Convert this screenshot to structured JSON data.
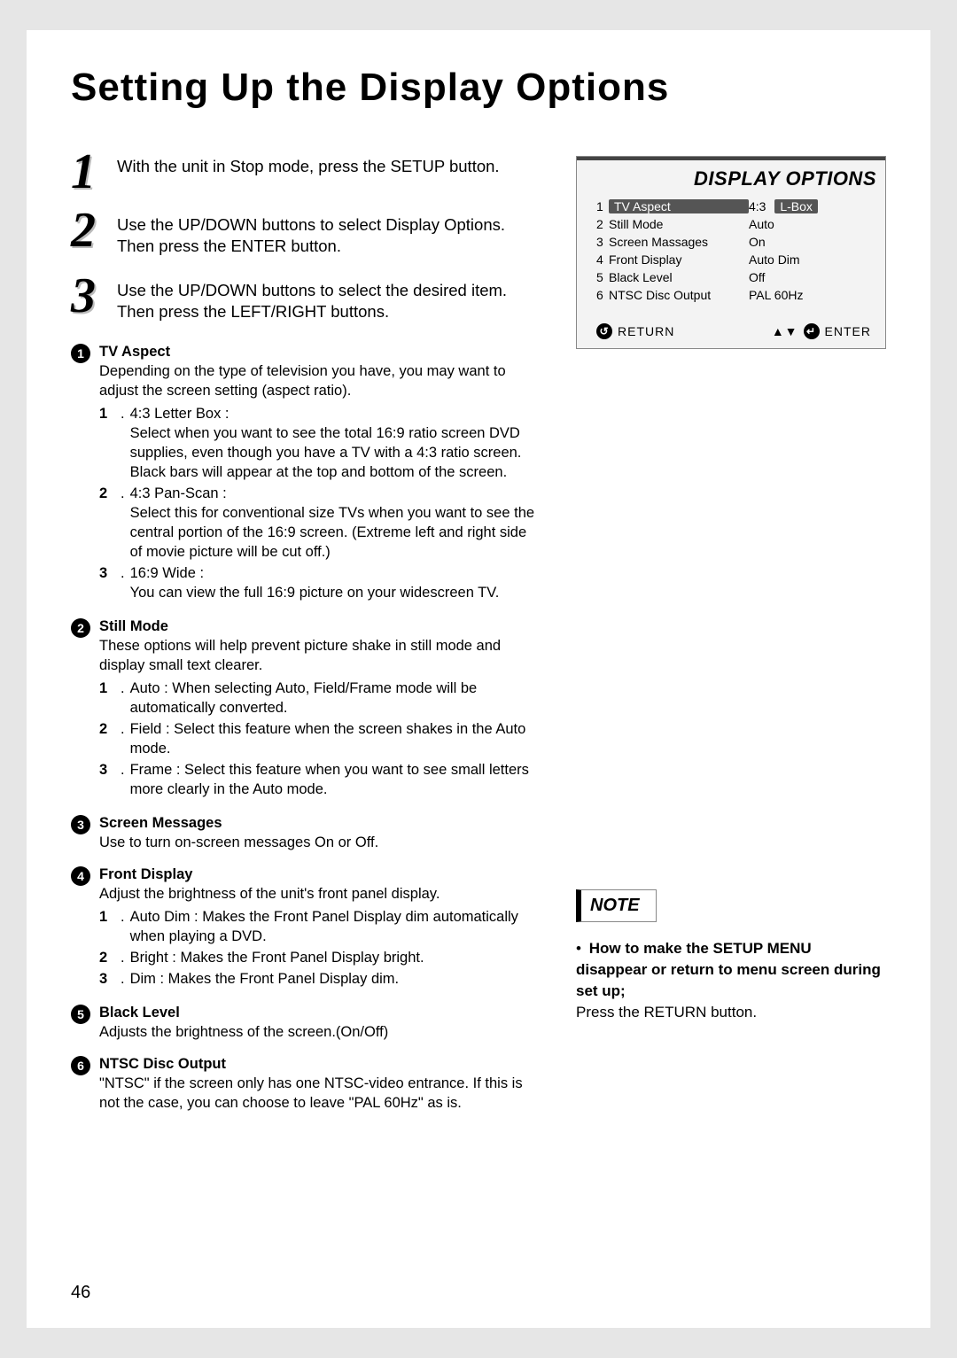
{
  "title": "Setting Up the Display Options",
  "page_number": "46",
  "steps": [
    {
      "num": "1",
      "text": "With the unit in Stop mode, press the SETUP button."
    },
    {
      "num": "2",
      "text": "Use the UP/DOWN buttons to select Display Options. Then press the ENTER button."
    },
    {
      "num": "3",
      "text": "Use the UP/DOWN buttons to select the desired item. Then press the LEFT/RIGHT buttons."
    }
  ],
  "details": {
    "tv_aspect": {
      "title": "TV Aspect",
      "intro": "Depending on the type of television you have, you may want to adjust the screen setting (aspect ratio).",
      "items": [
        {
          "n": "1",
          "label": "4:3 Letter Box :",
          "body": "Select when you want to see the total 16:9 ratio screen DVD supplies, even though you have a TV with a 4:3 ratio screen. Black bars will appear at the top and bottom of the screen."
        },
        {
          "n": "2",
          "label": "4:3 Pan-Scan :",
          "body": "Select this for conventional size TVs when you want to see the central portion of the 16:9 screen. (Extreme left and right side of movie picture will be cut off.)"
        },
        {
          "n": "3",
          "label": "16:9 Wide :",
          "body": "You can view the full 16:9 picture on your widescreen TV."
        }
      ]
    },
    "still_mode": {
      "title": "Still Mode",
      "intro": "These options will help prevent picture shake in still mode and display small text clearer.",
      "items": [
        {
          "n": "1",
          "body": "Auto : When selecting Auto, Field/Frame mode will be automatically converted."
        },
        {
          "n": "2",
          "body": "Field : Select this feature when the screen shakes in the Auto mode."
        },
        {
          "n": "3",
          "body": "Frame : Select this feature when you want to see small letters more clearly in the Auto mode."
        }
      ]
    },
    "screen_messages": {
      "title": "Screen Messages",
      "intro": "Use to turn on-screen messages On or Off."
    },
    "front_display": {
      "title": "Front Display",
      "intro": "Adjust the brightness of the unit's front panel display.",
      "items": [
        {
          "n": "1",
          "body": "Auto Dim : Makes the Front Panel Display dim automatically when playing a DVD."
        },
        {
          "n": "2",
          "body": "Bright : Makes the Front Panel Display bright."
        },
        {
          "n": "3",
          "body": "Dim : Makes the Front Panel Display dim."
        }
      ]
    },
    "black_level": {
      "title": "Black Level",
      "intro": "Adjusts the brightness of the screen.(On/Off)"
    },
    "ntsc": {
      "title": "NTSC Disc Output",
      "intro": "\"NTSC\" if the screen only has one NTSC-video entrance. If this is not the case, you can choose to leave \"PAL 60Hz\" as is."
    }
  },
  "menu": {
    "title": "DISPLAY OPTIONS",
    "rows": [
      {
        "n": "1",
        "label": "TV Aspect",
        "val": "4:3",
        "pill": "L-Box",
        "hl": true
      },
      {
        "n": "2",
        "label": "Still Mode",
        "val": "Auto"
      },
      {
        "n": "3",
        "label": "Screen Massages",
        "val": "On"
      },
      {
        "n": "4",
        "label": "Front Display",
        "val": "Auto Dim"
      },
      {
        "n": "5",
        "label": "Black Level",
        "val": "Off"
      },
      {
        "n": "6",
        "label": "NTSC Disc Output",
        "val": "PAL 60Hz"
      }
    ],
    "footer_left": "RETURN",
    "footer_right": "ENTER"
  },
  "note": {
    "label": "NOTE",
    "lead": "How to make the SETUP MENU disappear or return to menu screen during set up;",
    "body": "Press the RETURN button."
  }
}
